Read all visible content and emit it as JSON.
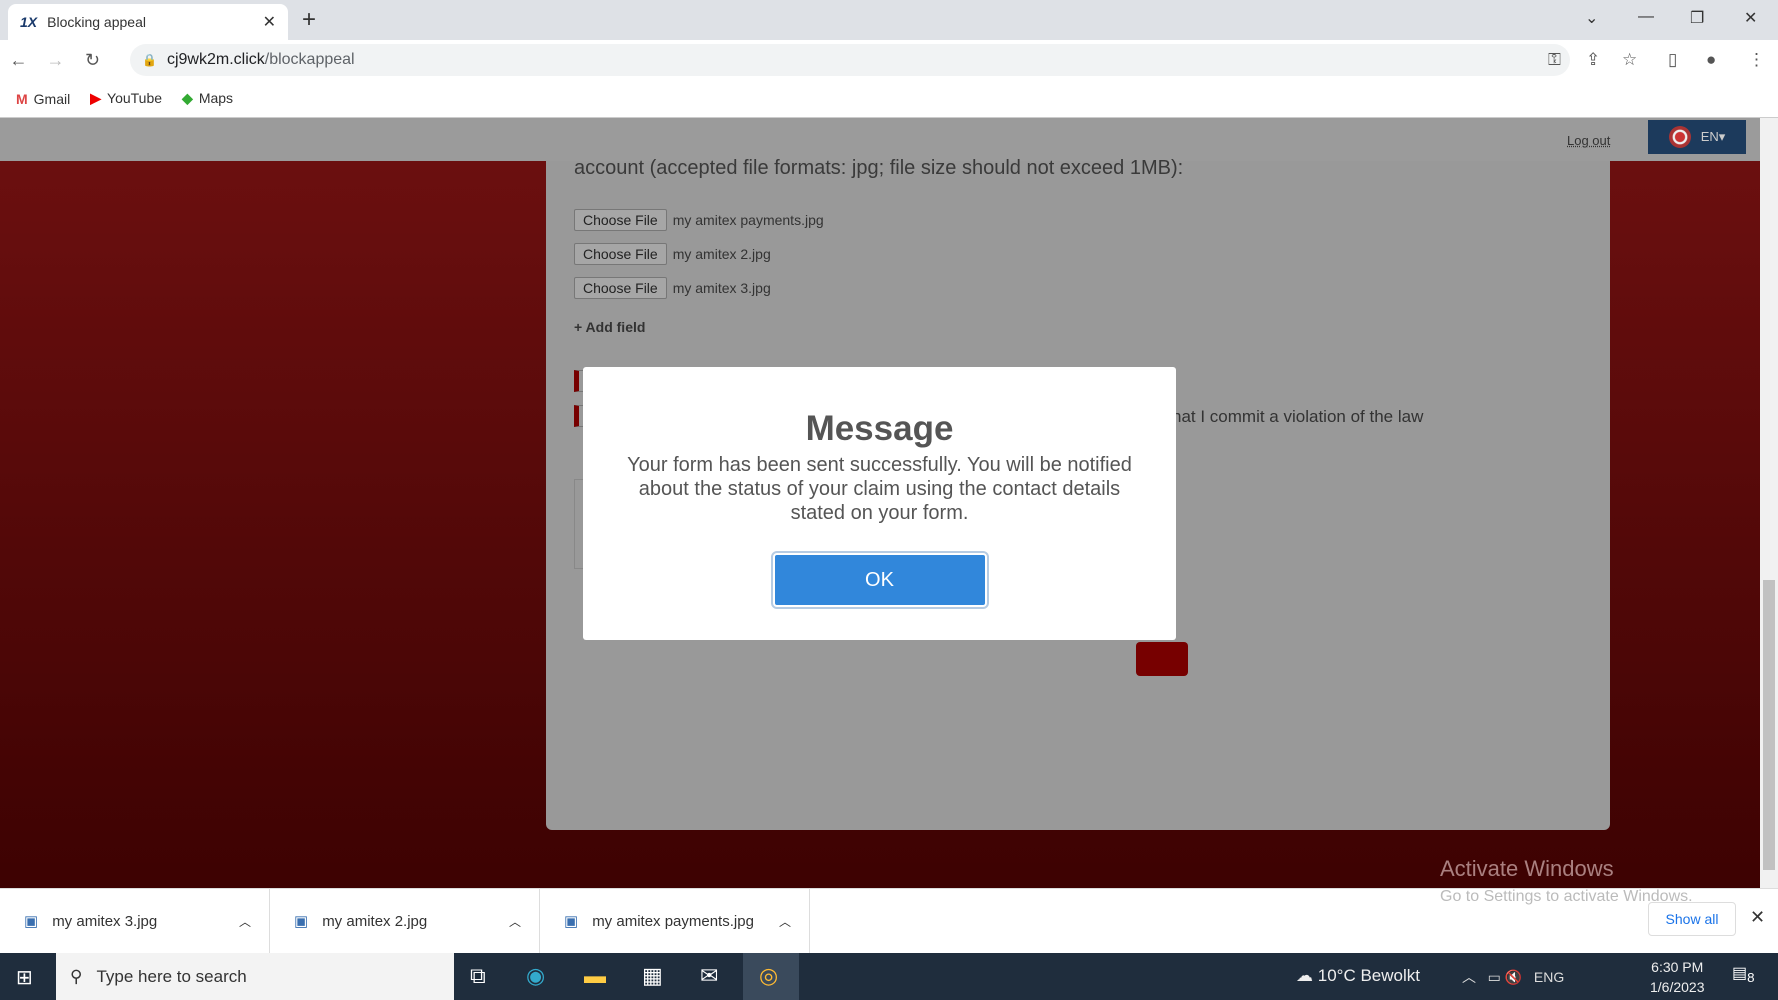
{
  "browser": {
    "tab_title": "Blocking appeal",
    "tab_logo": "1X",
    "url_host": "cj9wk2m.click",
    "url_path": "/blockappeal",
    "bookmarks": [
      {
        "label": "Gmail",
        "icon": "gmail-icon"
      },
      {
        "label": "YouTube",
        "icon": "youtube-icon"
      },
      {
        "label": "Maps",
        "icon": "maps-icon"
      }
    ]
  },
  "header": {
    "logout": "Log out",
    "language": "EN▾"
  },
  "form": {
    "instruction": "account (accepted file formats: jpg; file size should not exceed 1MB):",
    "files": [
      {
        "button": "Choose File",
        "name": "my amitex payments.jpg"
      },
      {
        "button": "Choose File",
        "name": "my amitex 2.jpg"
      },
      {
        "button": "Choose File",
        "name": "my amitex 3.jpg"
      }
    ],
    "add_field": "+ Add field",
    "checkbox_text_partial": "hat I commit a violation of the law"
  },
  "dialog": {
    "title": "Message",
    "message": "Your form has been sent successfully. You will be notified about the status of your claim using the contact details stated on your form.",
    "ok": "OK"
  },
  "watermark": {
    "line1": "Activate Windows",
    "line2": "Go to Settings to activate Windows."
  },
  "downloads": {
    "items": [
      "my amitex 3.jpg",
      "my amitex 2.jpg",
      "my amitex payments.jpg"
    ],
    "show_all": "Show all"
  },
  "taskbar": {
    "search_placeholder": "Type here to search",
    "weather": "10°C  Bewolkt",
    "lang": "ENG",
    "time": "6:30 PM",
    "date": "1/6/2023",
    "notifications": "8"
  },
  "colors": {
    "accent": "#3187db",
    "page_bg": "#6e1010"
  }
}
